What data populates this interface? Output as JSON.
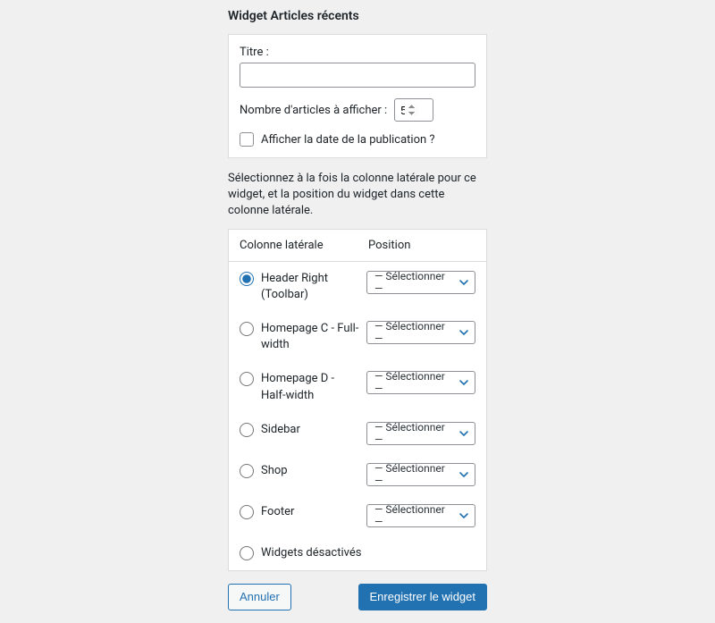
{
  "heading": "Widget Articles récents",
  "form": {
    "title_label": "Titre :",
    "title_value": "",
    "count_label": "Nombre d'articles à afficher :",
    "count_value": "5",
    "show_date_label": "Afficher la date de la publication ?"
  },
  "help_text": "Sélectionnez à la fois la colonne latérale pour ce widget, et la position du widget dans cette colonne latérale.",
  "table": {
    "col_sidebar": "Colonne latérale",
    "col_position": "Position",
    "position_placeholder": "— Sélectionner —"
  },
  "sidebars": [
    {
      "label": "Header Right (Toolbar)",
      "selected": true,
      "has_select": true
    },
    {
      "label": "Homepage C - Full-width",
      "selected": false,
      "has_select": true
    },
    {
      "label": "Homepage D - Half-width",
      "selected": false,
      "has_select": true
    },
    {
      "label": "Sidebar",
      "selected": false,
      "has_select": true
    },
    {
      "label": "Shop",
      "selected": false,
      "has_select": true
    },
    {
      "label": "Footer",
      "selected": false,
      "has_select": true
    },
    {
      "label": "Widgets désactivés",
      "selected": false,
      "has_select": false
    }
  ],
  "actions": {
    "cancel": "Annuler",
    "submit": "Enregistrer le widget"
  }
}
